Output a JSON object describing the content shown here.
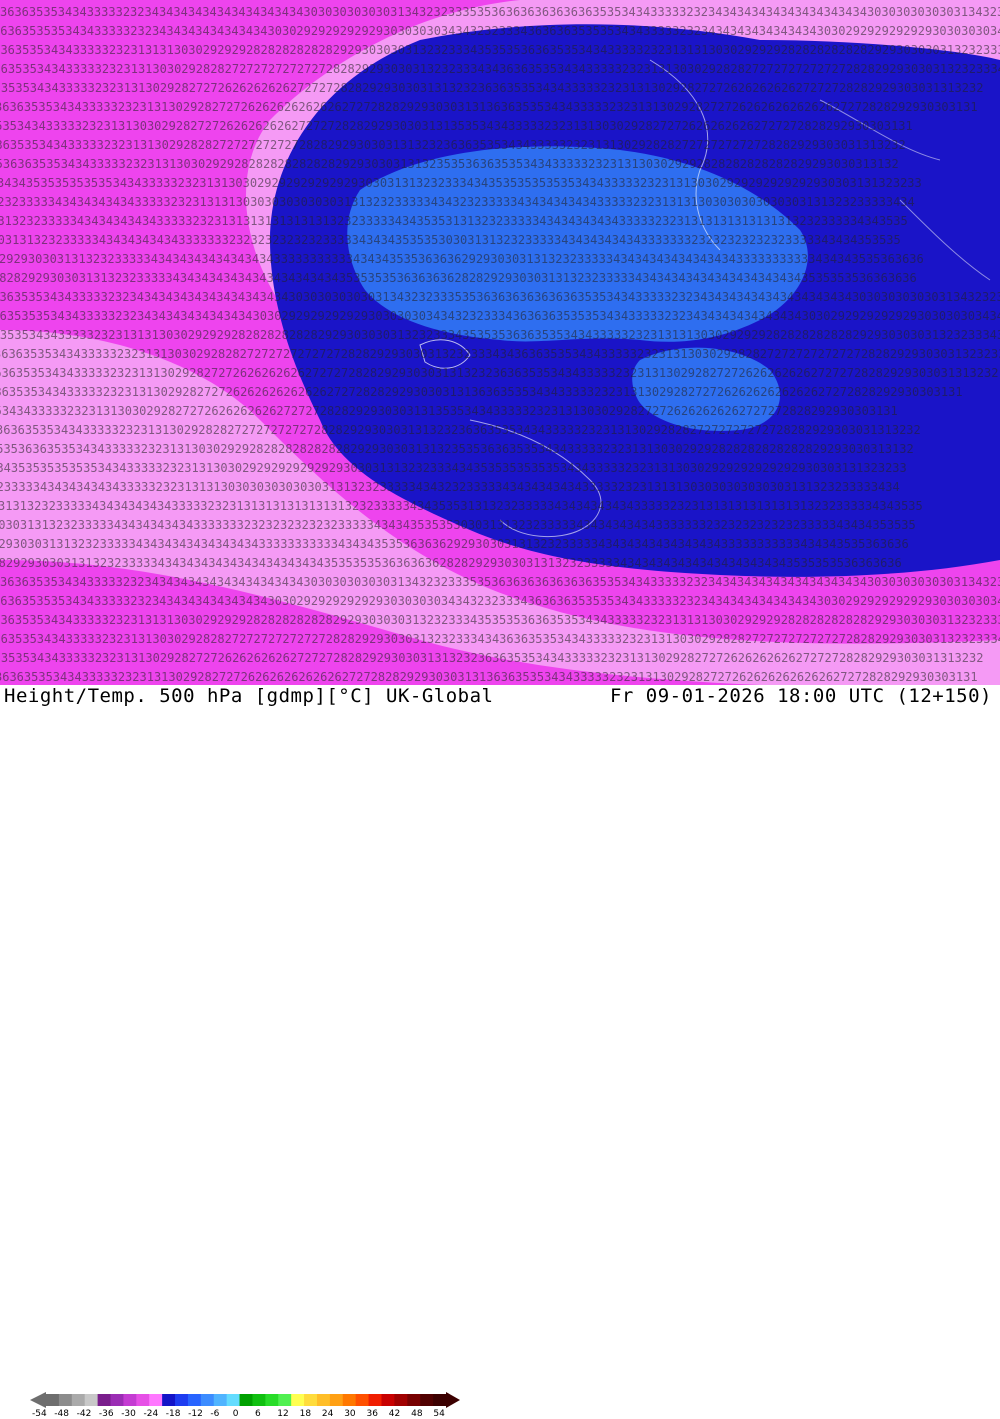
{
  "header": {
    "title_left": "Height/Temp. 500 hPa [gdmp][°C] UK-Global",
    "title_right": "Fr 09-01-2026 18:00 UTC (12+150)"
  },
  "colorbar": {
    "labels": [
      "-54",
      "-48",
      "-42",
      "-36",
      "-30",
      "-24",
      "-18",
      "-12",
      "-6",
      "0",
      "6",
      "12",
      "18",
      "24",
      "30",
      "36",
      "42",
      "48",
      "54"
    ],
    "colors": [
      "#6e6e6e",
      "#8c8c8c",
      "#aaaaaa",
      "#c8c8c8",
      "#7a1e8c",
      "#9b2db4",
      "#c43cd2",
      "#e650e6",
      "#ff78ff",
      "#1414c8",
      "#1e3cf0",
      "#2864ff",
      "#3c8cff",
      "#50b4ff",
      "#64dcff",
      "#00a000",
      "#10c010",
      "#28dc28",
      "#50f050",
      "#ffff50",
      "#ffdc3c",
      "#ffbe28",
      "#ffa014",
      "#ff7800",
      "#ff5000",
      "#f01e00",
      "#c80000",
      "#a00000",
      "#780000",
      "#500000",
      "#3c0000"
    ]
  },
  "map": {
    "colors": {
      "magenta": "#ee44ee",
      "pink": "#f59af5",
      "navy": "#1a14c8",
      "blue": "#2e6ef0",
      "blue_light": "#3c82ff"
    },
    "contour_rows": [
      "363635353434333332323434343434343434343434303030303030313432323335353636363636",
      "3636353535343433333232343434343434343430302929292929293030303034343232333436",
      "36363535343433333232313131303029292928282828282829293030303132323334353535",
      "363635353434333332323131303029282827272727272727282829293030313232333434",
      "3636353534343333323231313029282727262626262627272728282929303031313232",
      "36363535343433333232313130292827272626262626262627272828292930303131",
      "3535343433333232313130302928272726262626262727272828292930303131",
      "3636353534343333323231313029282827272727272728282929303031313232",
      "3535363635353434333332323131303029292828282828282829293030313132",
      "3434353535353535343433333232313130302929292929292930303131323233",
      "3232333334343434343433333232313131303030303030303131323233333434",
      "3131323233333434343434343333323231313131313131313232333334343535",
      "3030313132323333343434343434333333323232323232323333343434353535",
      "2929303031313232333334343434343434343433333333333434343535363636",
      "2828292930303131323233333434343434343434343434343535353536363636"
    ]
  }
}
